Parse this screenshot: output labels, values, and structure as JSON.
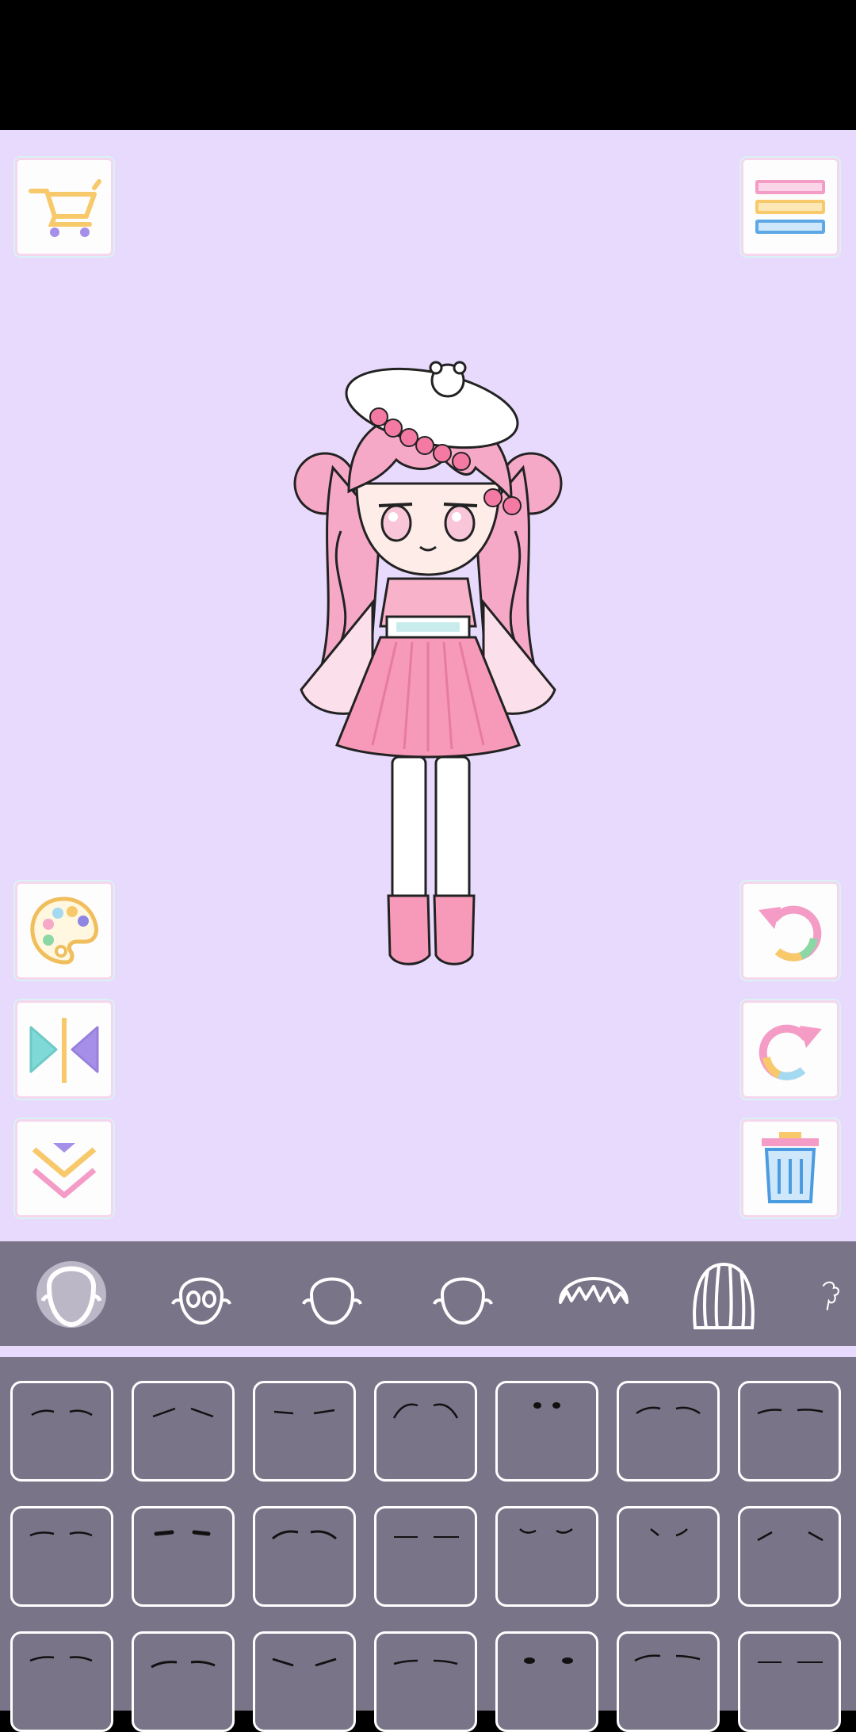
{
  "app": {
    "screen": "character-editor",
    "active_category": "eyebrows"
  },
  "colors": {
    "canvas_bg": "#e8dafd",
    "panel_bg": "#7a7489",
    "tile_border": "#ffffff",
    "status_bar": "#000000"
  },
  "toolbar": {
    "left": [
      "cart-icon",
      "palette-icon",
      "flip-icon",
      "collapse-icon"
    ],
    "right": [
      "menu-icon",
      "undo-icon",
      "redo-icon",
      "trash-icon"
    ]
  },
  "categories": [
    {
      "name": "body",
      "icon": "body-selected-icon",
      "selected": true
    },
    {
      "name": "eyes",
      "icon": "eyes-face-icon"
    },
    {
      "name": "mouth",
      "icon": "face-outline-icon"
    },
    {
      "name": "nose",
      "icon": "face-outline-icon"
    },
    {
      "name": "bangs",
      "icon": "bangs-hair-icon"
    },
    {
      "name": "hair",
      "icon": "long-hair-icon"
    },
    {
      "name": "more",
      "icon": "partial-hair-icon"
    }
  ],
  "eyebrow_grid": {
    "rows": 3,
    "columns": 7,
    "items": [
      "brow-thin-arched",
      "brow-thin-angled",
      "brow-thin-flat",
      "brow-high-arched",
      "brow-dots",
      "brow-soft-arched",
      "brow-thin-sloped",
      "brow-thin-wave",
      "brow-bold-dash",
      "brow-soft-curve",
      "brow-straight",
      "brow-small-dip",
      "brow-tiny-dip",
      "brow-angled-short",
      "brow-thin-wave-2",
      "brow-medium-curve",
      "brow-raised-v",
      "brow-flat-dash",
      "brow-bold-dots",
      "brow-thin-swoop",
      "brow-thin-straight"
    ]
  }
}
